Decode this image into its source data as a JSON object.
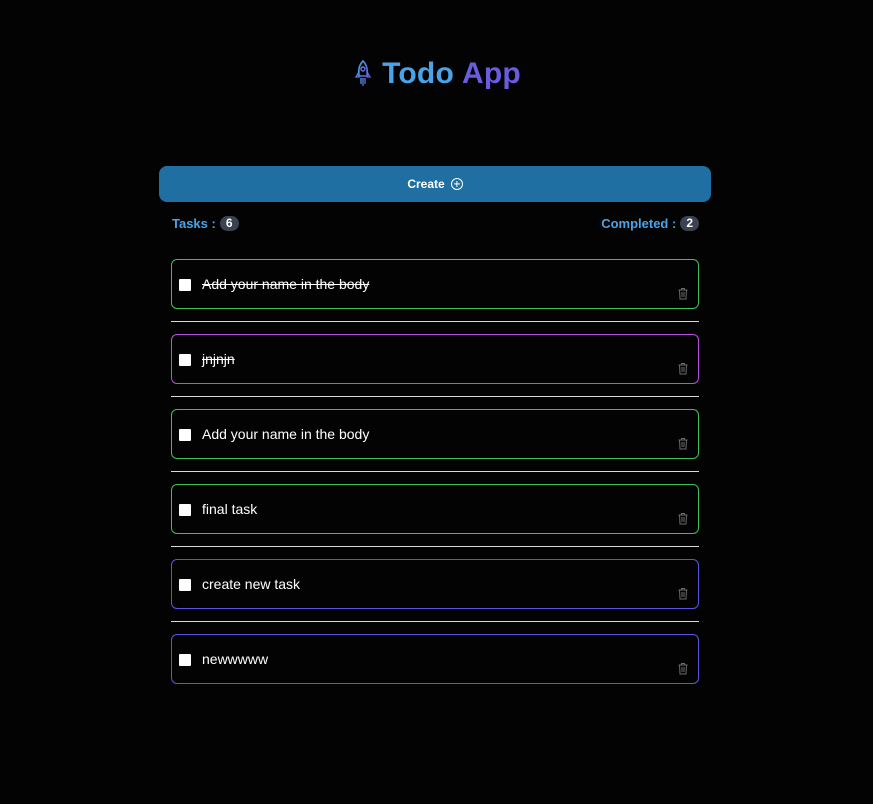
{
  "header": {
    "title_word1": "Todo",
    "title_word2": "App",
    "icon": "rocket-icon",
    "colors": {
      "word1": "#4aa3e8",
      "word2": "#6a5ce0"
    }
  },
  "create_button": {
    "label": "Create",
    "icon": "plus-circle-icon",
    "color": "#1f6fa3"
  },
  "stats": {
    "tasks_label": "Tasks :",
    "tasks_count": "6",
    "completed_label": "Completed :",
    "completed_count": "2"
  },
  "tasks": [
    {
      "text": "Add your name in the body",
      "completed": true,
      "border_color": "#3fbf5a"
    },
    {
      "text": "jnjnjn",
      "completed": true,
      "border_color": "#b64ee0"
    },
    {
      "text": "Add your name in the body",
      "completed": false,
      "border_color": "#3fbf5a"
    },
    {
      "text": "final task",
      "completed": false,
      "border_color": "#3fbf5a"
    },
    {
      "text": "create new task",
      "completed": false,
      "border_color": "#5b55de"
    },
    {
      "text": "newwwww",
      "completed": false,
      "border_color": "#5b55de"
    }
  ]
}
